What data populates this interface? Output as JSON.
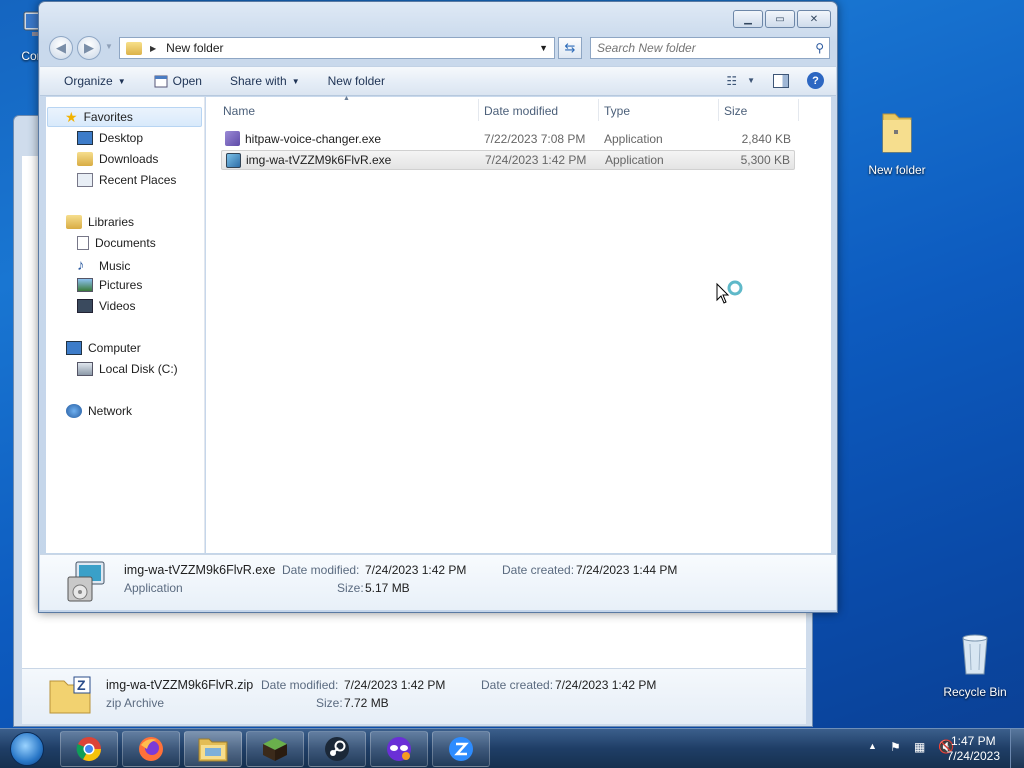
{
  "desktop": {
    "icons": [
      {
        "label": "Com"
      },
      {
        "label": "New folder"
      },
      {
        "label": "Recycle Bin"
      }
    ]
  },
  "window": {
    "address_path": "New folder",
    "search_placeholder": "Search New folder",
    "toolbar": {
      "organize": "Organize",
      "open": "Open",
      "share_with": "Share with",
      "new_folder": "New folder"
    },
    "nav": {
      "favorites": "Favorites",
      "desktop": "Desktop",
      "downloads": "Downloads",
      "recent_places": "Recent Places",
      "libraries": "Libraries",
      "documents": "Documents",
      "music": "Music",
      "pictures": "Pictures",
      "videos": "Videos",
      "computer": "Computer",
      "local_disk": "Local Disk (C:)",
      "network": "Network"
    },
    "columns": {
      "name": "Name",
      "date_modified": "Date modified",
      "type": "Type",
      "size": "Size"
    },
    "files": [
      {
        "name": "hitpaw-voice-changer.exe",
        "date": "7/22/2023 7:08 PM",
        "type": "Application",
        "size": "2,840 KB"
      },
      {
        "name": "img-wa-tVZZM9k6FlvR.exe",
        "date": "7/24/2023 1:42 PM",
        "type": "Application",
        "size": "5,300 KB"
      }
    ],
    "details": {
      "name": "img-wa-tVZZM9k6FlvR.exe",
      "type": "Application",
      "modified_label": "Date modified:",
      "modified_value": "7/24/2023 1:42 PM",
      "size_label": "Size:",
      "size_value": "5.17 MB",
      "created_label": "Date created:",
      "created_value": "7/24/2023 1:44 PM"
    }
  },
  "background_window": {
    "details": {
      "name": "img-wa-tVZZM9k6FlvR.zip",
      "type": "zip Archive",
      "modified_label": "Date modified:",
      "modified_value": "7/24/2023 1:42 PM",
      "size_label": "Size:",
      "size_value": "7.72 MB",
      "created_label": "Date created:",
      "created_value": "7/24/2023 1:42 PM"
    }
  },
  "taskbar": {
    "time": "1:47 PM",
    "date": "7/24/2023",
    "apps": [
      "chrome-icon",
      "firefox-icon",
      "explorer-icon",
      "minecraft-icon",
      "steam-icon",
      "mask-app-icon",
      "zoom-app-icon"
    ]
  },
  "colors": {
    "accent": "#2d67c2",
    "desktop_bg": "#1976d2",
    "selected_row": "#e4e4e4"
  }
}
